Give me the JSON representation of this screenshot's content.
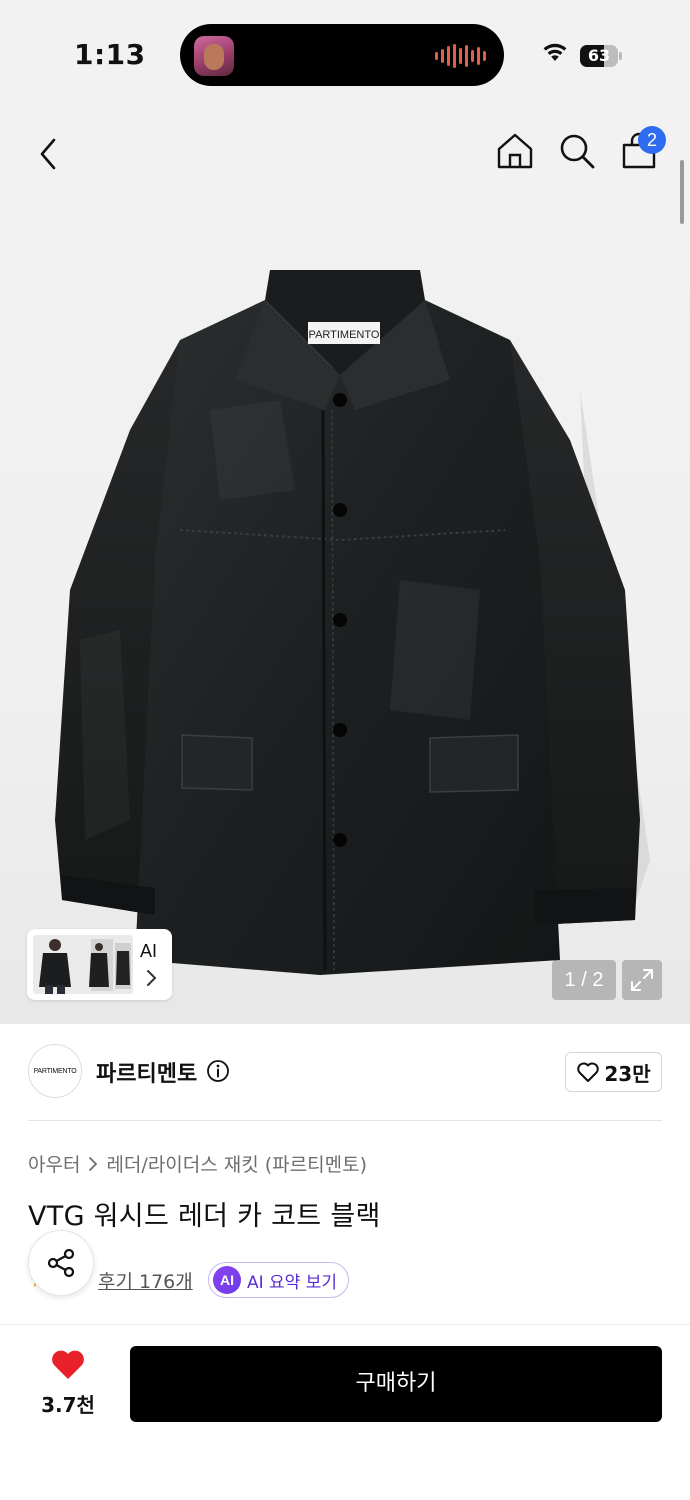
{
  "status_bar": {
    "time": "1:13",
    "battery_level": "63",
    "battery_fraction": 0.63
  },
  "header": {
    "back_icon": "chevron-left-icon",
    "home_icon": "home-icon",
    "search_icon": "search-icon",
    "cart_icon": "shopping-bag-icon",
    "cart_badge": "2",
    "badge_color": "#2f6bf0"
  },
  "gallery": {
    "label_text": "PARTIMENTO",
    "ai_thumb_label": "AI",
    "page_counter": "1 / 2",
    "expand_icon": "expand-icon"
  },
  "brand": {
    "logo_text": "PARTIMENTO",
    "name": "파르티멘토",
    "info_icon": "info-icon",
    "like_icon": "heart-outline-icon",
    "like_count": "23만"
  },
  "product": {
    "breadcrumb": [
      "아우터",
      "레더/라이더스 재킷 (파르티멘토)"
    ],
    "title": "VTG 워시드 레더 카 코트 블랙",
    "review_link": "후기 176개",
    "ai_badge": "AI",
    "ai_summary_label": "AI 요약 보기",
    "ai_accent": "#6d3ae8"
  },
  "bottom_bar": {
    "wish_icon": "heart-filled-icon",
    "wish_color": "#e8202a",
    "wish_count": "3.7천",
    "buy_label": "구매하기"
  }
}
